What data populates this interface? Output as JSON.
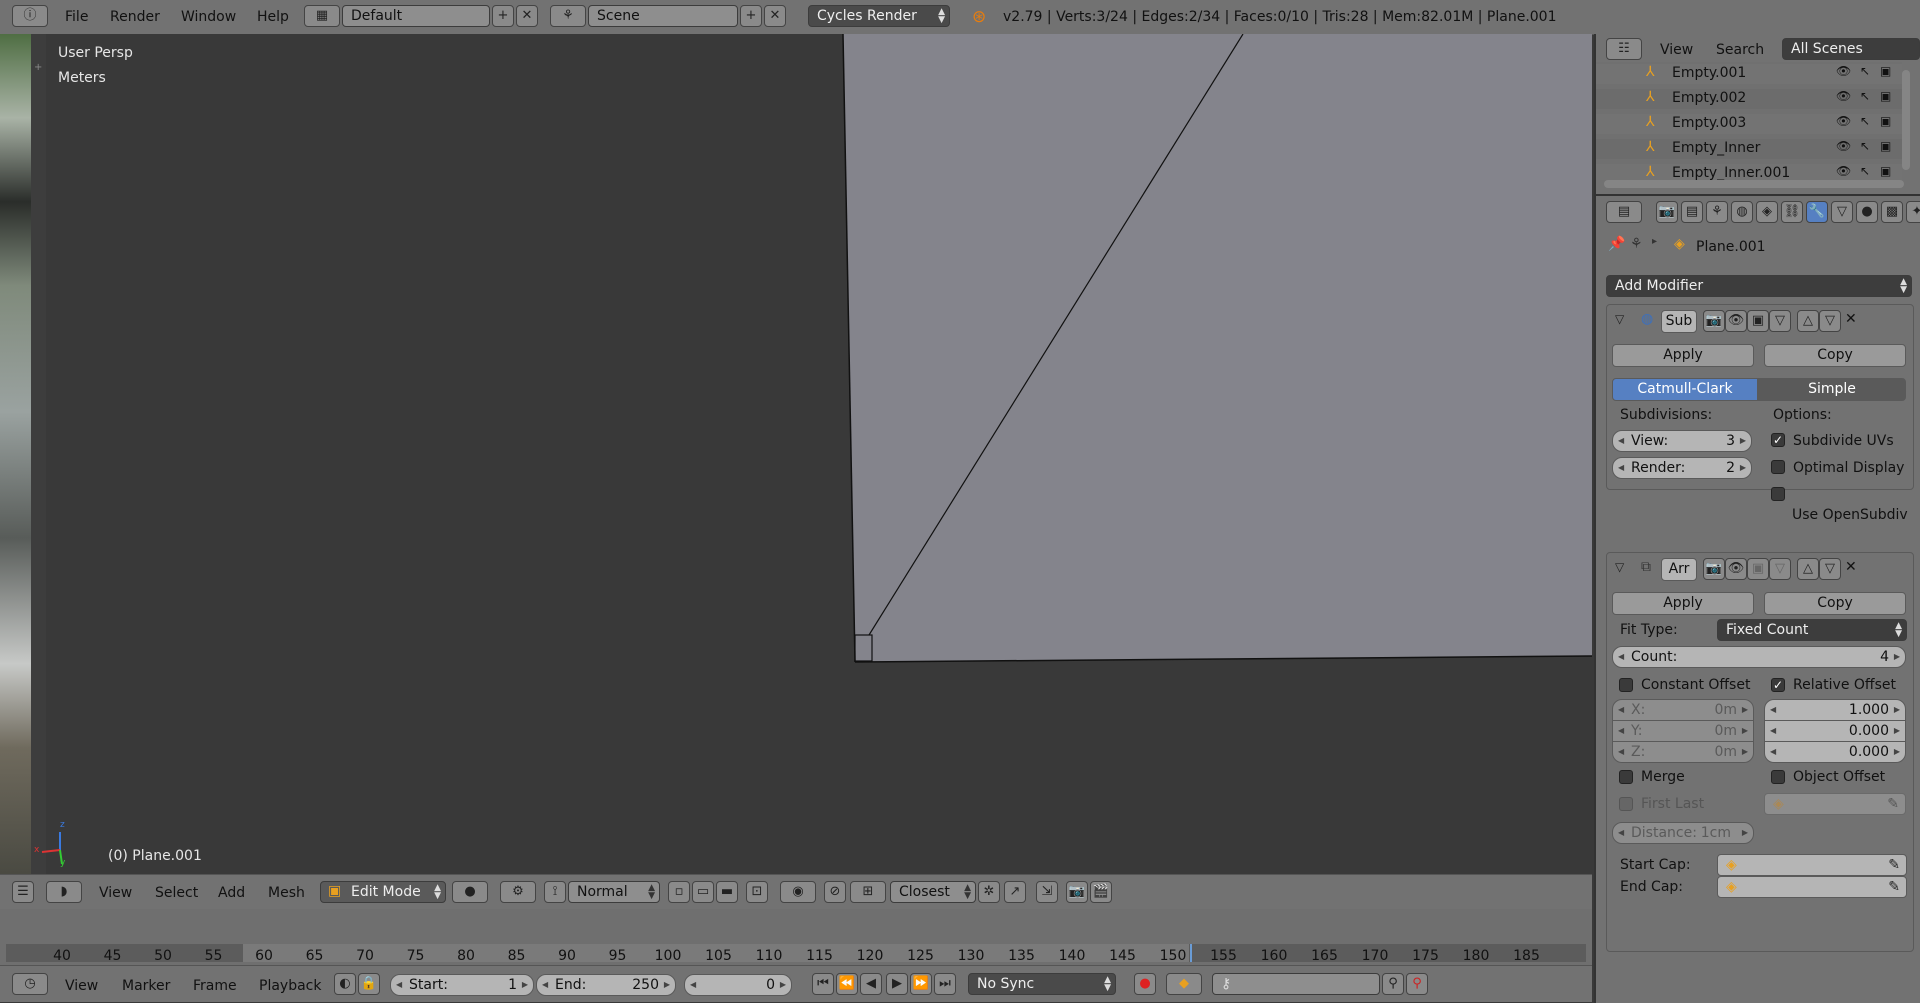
{
  "top": {
    "menus": [
      "File",
      "Render",
      "Window",
      "Help"
    ],
    "layout": "Default",
    "scene": "Scene",
    "engine": "Cycles Render",
    "stats": "v2.79 | Verts:3/24 | Edges:2/34 | Faces:0/10 | Tris:28 | Mem:82.01M | Plane.001"
  },
  "viewport": {
    "view_name": "User Persp",
    "units": "Meters",
    "object_label": "(0) Plane.001",
    "axis_x": "x",
    "axis_y": "y",
    "axis_z": "z"
  },
  "header3d": {
    "menus": [
      "View",
      "Select",
      "Add",
      "Mesh"
    ],
    "mode": "Edit Mode",
    "orientation": "Normal",
    "snap": "Closest"
  },
  "outliner": {
    "menus": [
      "View",
      "Search"
    ],
    "filter": "All Scenes",
    "items": [
      "Empty.001",
      "Empty.002",
      "Empty.003",
      "Empty_Inner",
      "Empty_Inner.001"
    ]
  },
  "properties": {
    "object": "Plane.001",
    "add_modifier": "Add Modifier",
    "subsurf": {
      "name": "Sub",
      "apply": "Apply",
      "copy": "Copy",
      "type_a": "Catmull-Clark",
      "type_b": "Simple",
      "subdivisions_label": "Subdivisions:",
      "options_label": "Options:",
      "view_label": "View:",
      "view_val": "3",
      "render_label": "Render:",
      "render_val": "2",
      "opt1": "Subdivide UVs",
      "opt2": "Optimal Display",
      "opt3": "Use OpenSubdiv",
      "opt1_checked": true,
      "opt2_checked": false,
      "opt3_checked": false
    },
    "array": {
      "name": "Arr",
      "apply": "Apply",
      "copy": "Copy",
      "fit_label": "Fit Type:",
      "fit_value": "Fixed Count",
      "count_label": "Count:",
      "count_val": "4",
      "constant": "Constant Offset",
      "relative": "Relative Offset",
      "constant_checked": false,
      "relative_checked": true,
      "cx_label": "X:",
      "cx_val": "0m",
      "cy_label": "Y:",
      "cy_val": "0m",
      "cz_label": "Z:",
      "cz_val": "0m",
      "rx_val": "1.000",
      "ry_val": "0.000",
      "rz_val": "0.000",
      "merge": "Merge",
      "object_offset": "Object Offset",
      "first_last": "First Last",
      "distance_label": "Distance:",
      "distance_val": "1cm",
      "start_cap": "Start Cap:",
      "end_cap": "End Cap:"
    }
  },
  "timeline": {
    "ticks": [
      "40",
      "45",
      "50",
      "55",
      "60",
      "65",
      "70",
      "75",
      "80",
      "85",
      "90",
      "95",
      "100",
      "105",
      "110",
      "115",
      "120",
      "125",
      "130",
      "135",
      "140",
      "145",
      "150",
      "155",
      "160",
      "165",
      "170",
      "175",
      "180",
      "185"
    ],
    "menus": [
      "View",
      "Marker",
      "Frame",
      "Playback"
    ],
    "start_label": "Start:",
    "start_val": "1",
    "end_label": "End:",
    "end_val": "250",
    "current": "0",
    "sync": "No Sync"
  },
  "colors": {
    "accent": "#5680c2",
    "viewport_bg": "#393939",
    "mesh_face": "#84848c",
    "header": "#727272"
  }
}
